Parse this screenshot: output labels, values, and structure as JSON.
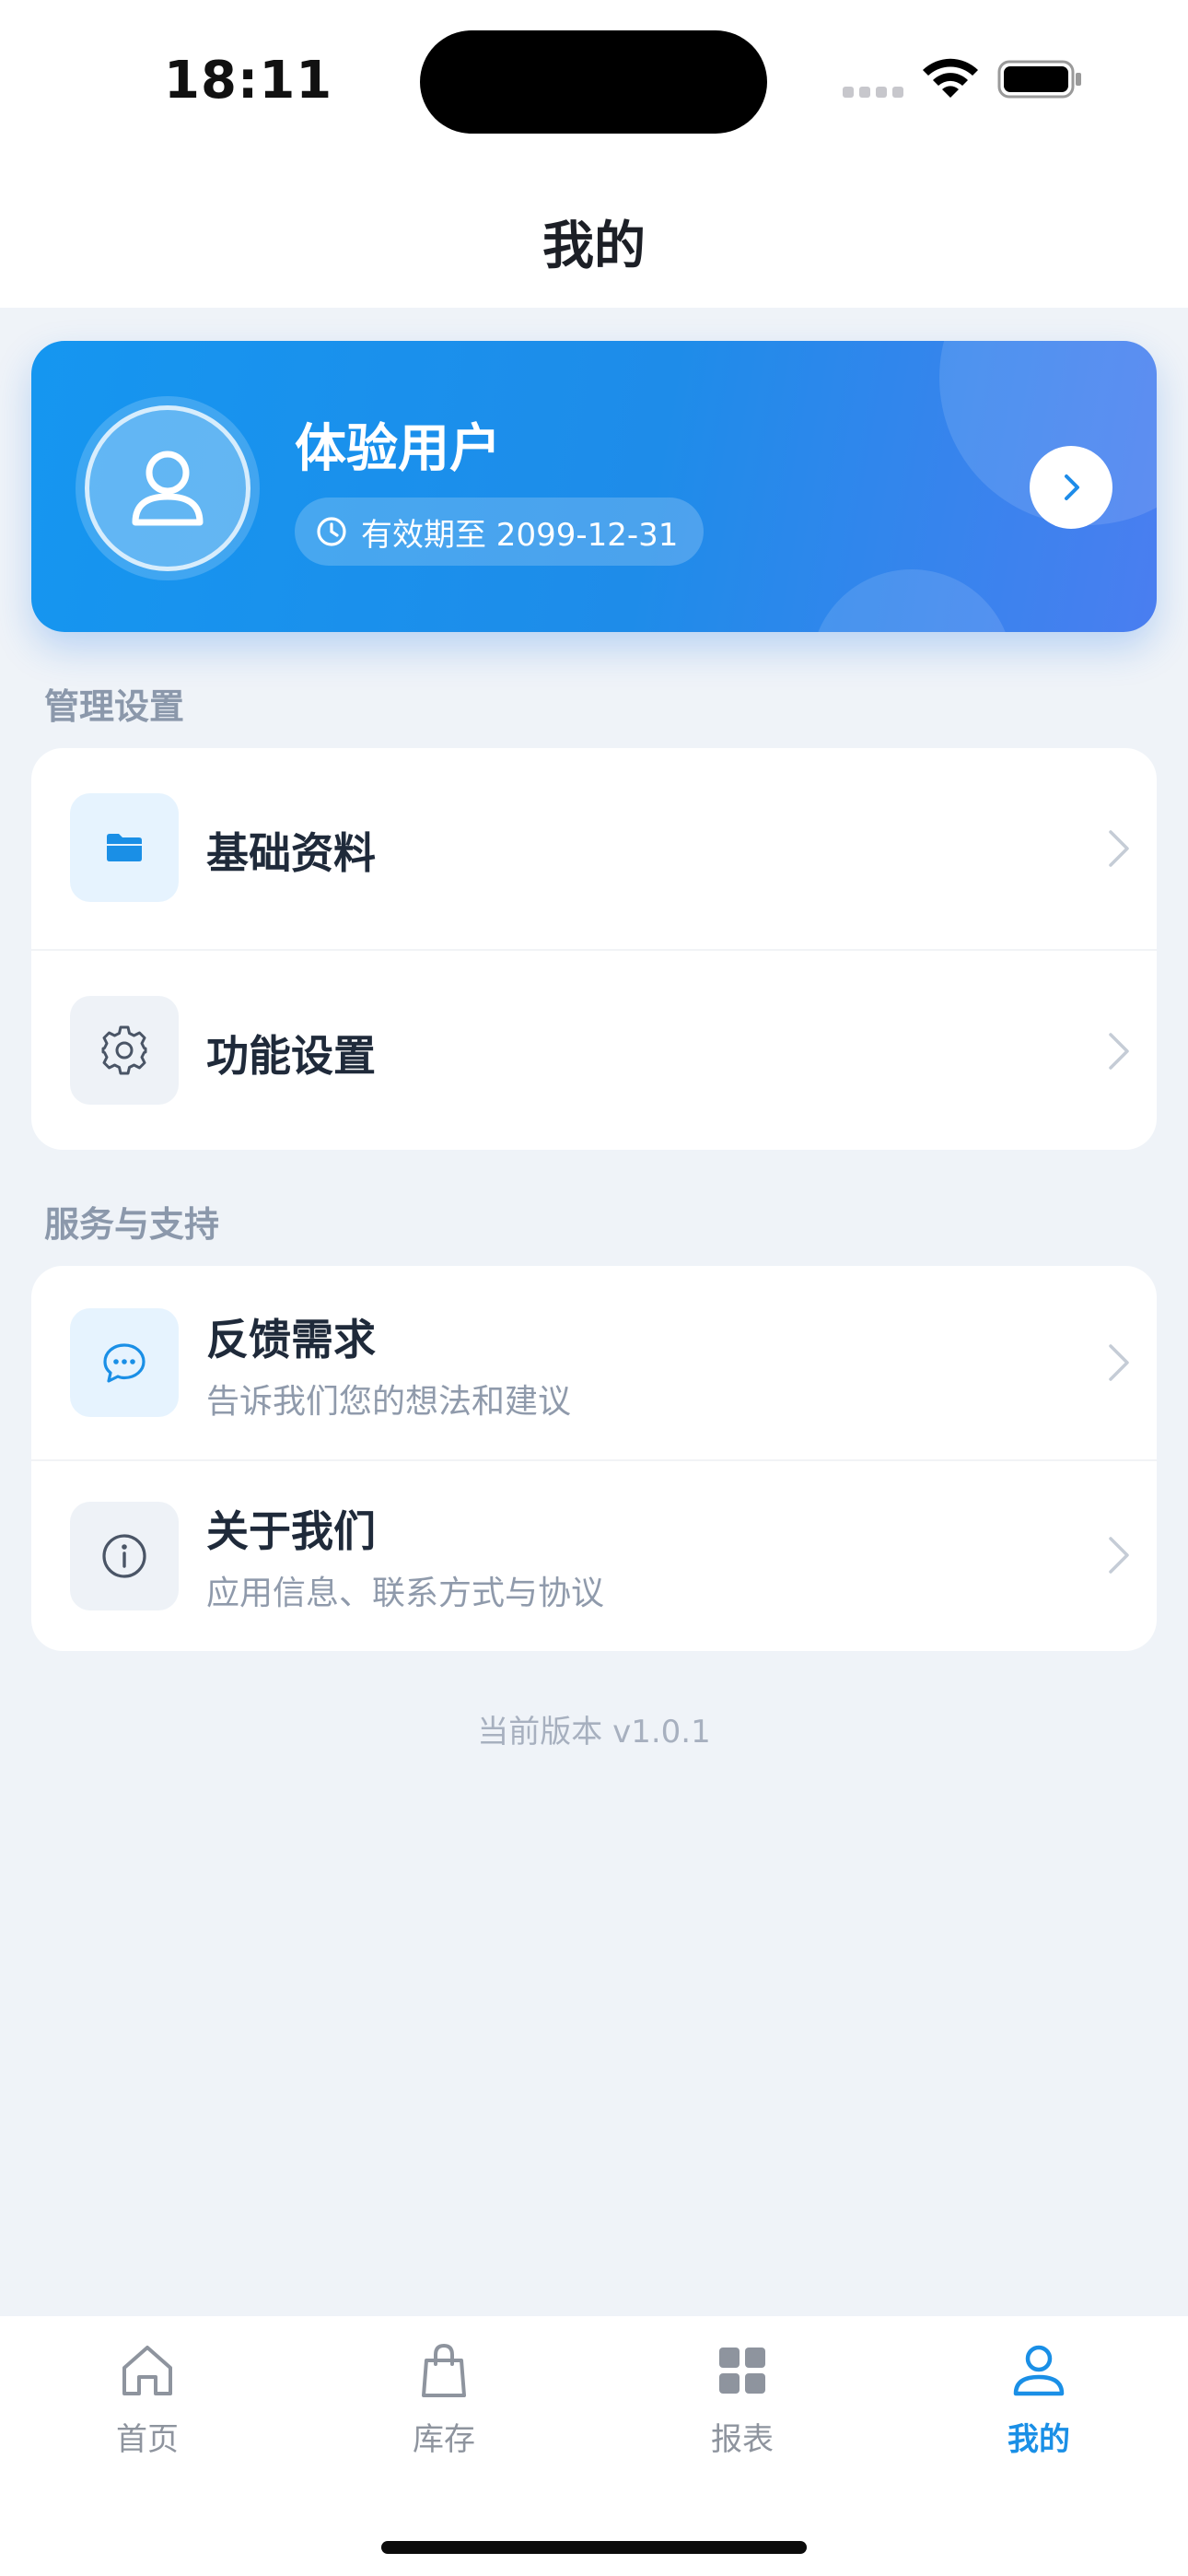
{
  "status_bar": {
    "time": "18:11"
  },
  "nav": {
    "title": "我的"
  },
  "profile": {
    "name": "体验用户",
    "expiry": "有效期至 2099-12-31"
  },
  "sections": {
    "management": {
      "title": "管理设置",
      "items": [
        {
          "label": "基础资料",
          "icon": "folder-icon"
        },
        {
          "label": "功能设置",
          "icon": "gear-icon"
        }
      ]
    },
    "service": {
      "title": "服务与支持",
      "items": [
        {
          "label": "反馈需求",
          "subtitle": "告诉我们您的想法和建议",
          "icon": "chat-bubble-icon"
        },
        {
          "label": "关于我们",
          "subtitle": "应用信息、联系方式与协议",
          "icon": "info-icon"
        }
      ]
    }
  },
  "version": "当前版本 v1.0.1",
  "tabbar": {
    "tabs": [
      {
        "label": "首页",
        "icon": "home-icon",
        "active": false
      },
      {
        "label": "库存",
        "icon": "shopping-bag-icon",
        "active": false
      },
      {
        "label": "报表",
        "icon": "grid-icon",
        "active": false
      },
      {
        "label": "我的",
        "icon": "user-icon",
        "active": true
      }
    ]
  },
  "colors": {
    "accent": "#1a8fe6",
    "background": "#eff3f8",
    "card_gradient_start": "#1596f0",
    "card_gradient_end": "#4a7ef0"
  }
}
